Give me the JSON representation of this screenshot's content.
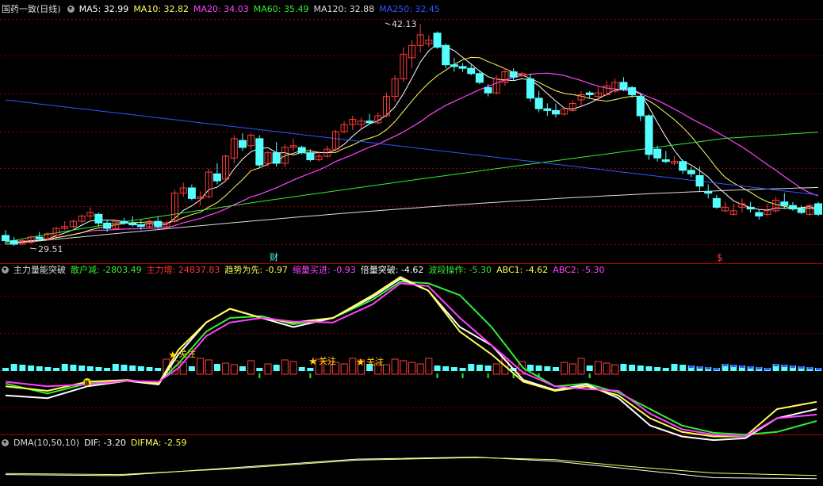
{
  "main_panel": {
    "title": "国药一致(日线)",
    "ma_labels": [
      {
        "text": "MA5: 32.99",
        "color": "#ffffff"
      },
      {
        "text": "MA10: 32.82",
        "color": "#ffff66"
      },
      {
        "text": "MA20: 34.03",
        "color": "#ff44ff"
      },
      {
        "text": "MA60: 35.49",
        "color": "#33ee33"
      },
      {
        "text": "MA120: 32.88",
        "color": "#dddddd"
      },
      {
        "text": "MA250: 32.45",
        "color": "#3355ff"
      }
    ],
    "high_label": "42.13",
    "low_label": "29.51",
    "event_marker_finance": "财",
    "event_marker_dividend": "$"
  },
  "indicator_panel": {
    "title": "主力量能突破",
    "labels": [
      {
        "text": "散户减: -2803.49",
        "color": "#33ee33"
      },
      {
        "text": "主力增: 24837.83",
        "color": "#ff3333"
      },
      {
        "text": "趋势为先: -0.97",
        "color": "#ffff55"
      },
      {
        "text": "缩量买进: -0.93",
        "color": "#ff44ff"
      },
      {
        "text": "倍量突破: -4.62",
        "color": "#ffffff"
      },
      {
        "text": "波段操作: -5.30",
        "color": "#33ee33"
      },
      {
        "text": "ABC1: -4.62",
        "color": "#ffff55"
      },
      {
        "text": "ABC2: -5.30",
        "color": "#ff44ff"
      }
    ],
    "focus_label": "关注",
    "buy_marker": "B"
  },
  "dma_panel": {
    "title": "DMA(10,50,10)",
    "labels": [
      {
        "text": "DIF: -3.20",
        "color": "#ffffff"
      },
      {
        "text": "DIFMA: -2.59",
        "color": "#ffff55"
      }
    ]
  },
  "colors": {
    "up": "#ff3b3b",
    "down": "#55ffff",
    "grid": "#8b0000",
    "separator": "#b00000"
  }
}
